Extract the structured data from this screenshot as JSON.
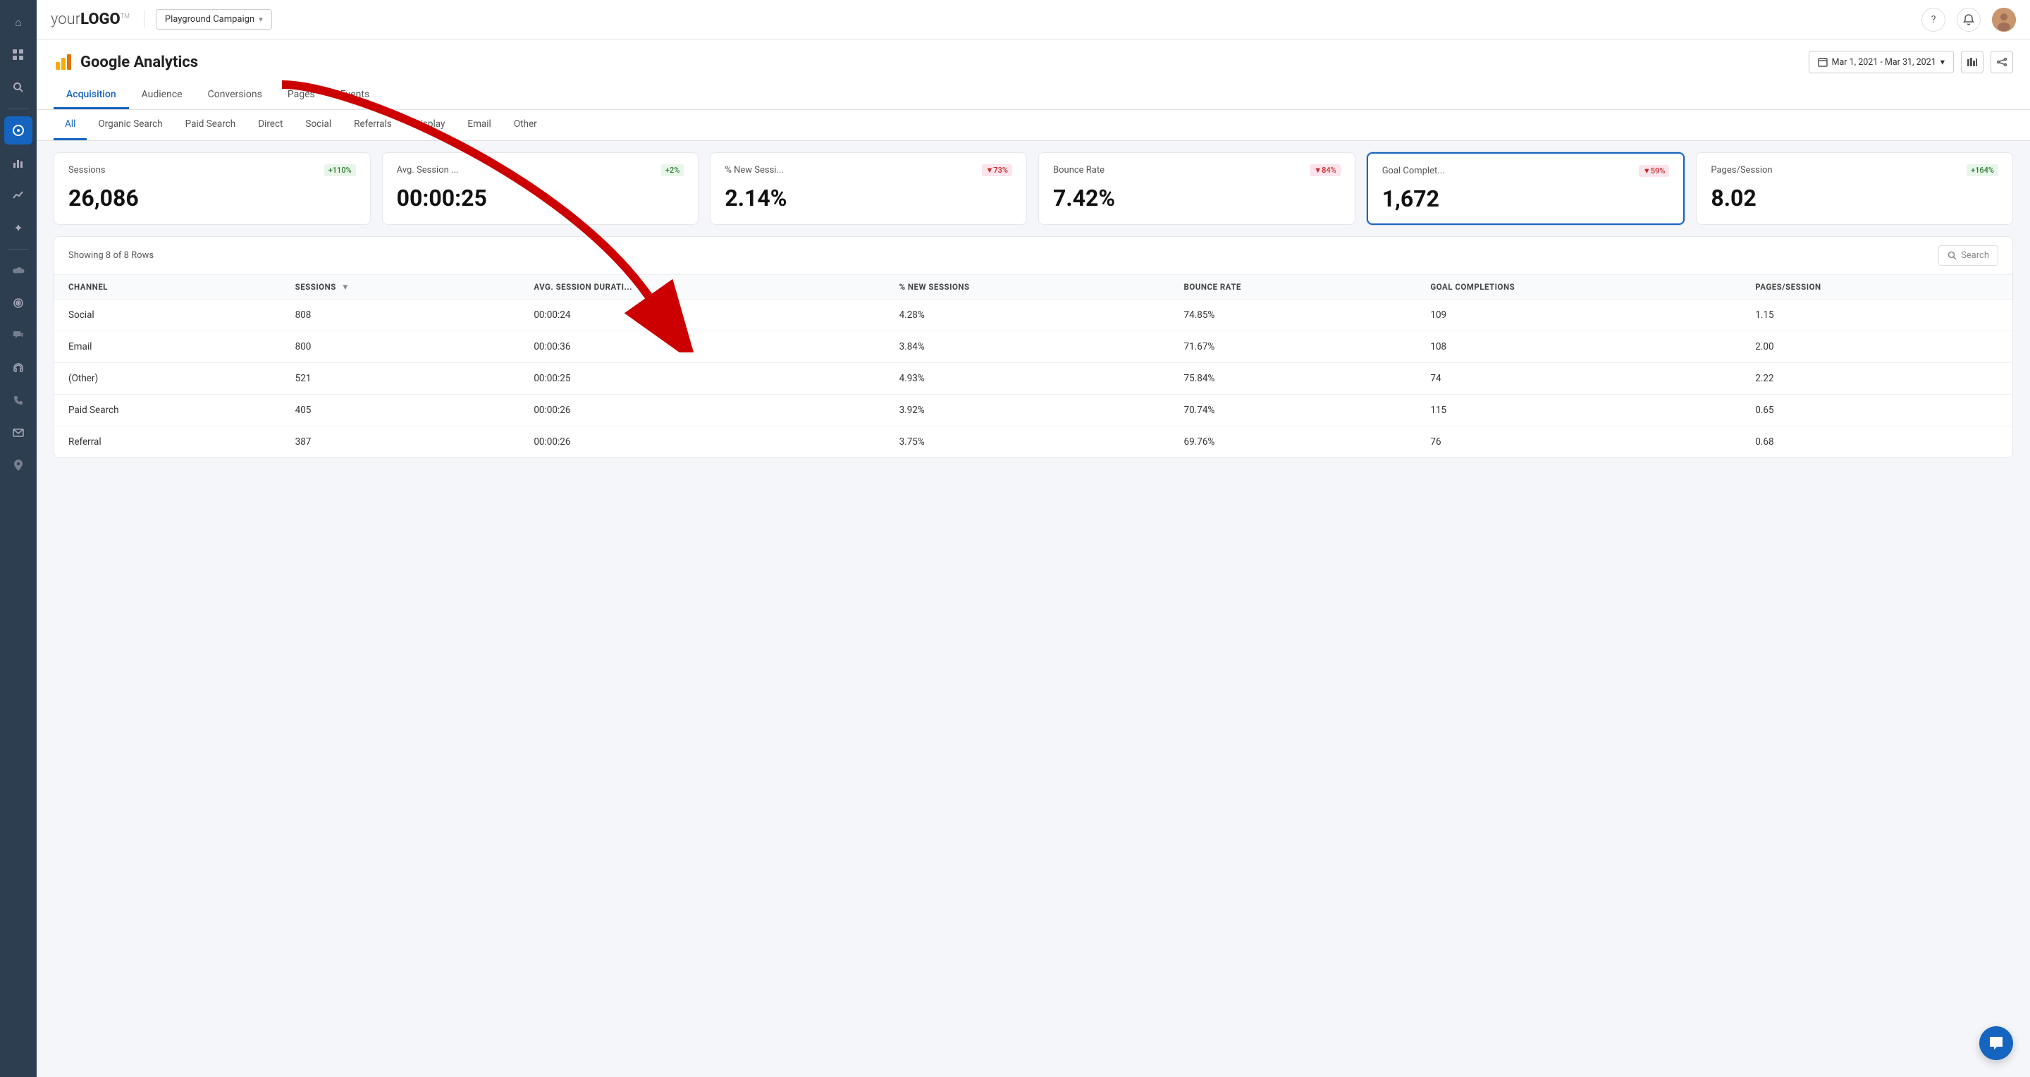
{
  "logo": {
    "text_before": "your",
    "text_bold": "LOGO",
    "tm": "TM"
  },
  "campaign": {
    "label": "Playground Campaign",
    "arrow": "▾"
  },
  "header": {
    "help_icon": "?",
    "bell_icon": "🔔"
  },
  "date_range": {
    "label": "Mar 1, 2021 - Mar 31, 2021",
    "arrow": "▾"
  },
  "main_nav": {
    "tabs": [
      {
        "label": "Acquisition",
        "active": true
      },
      {
        "label": "Audience",
        "active": false
      },
      {
        "label": "Conversions",
        "active": false
      },
      {
        "label": "Pages",
        "active": false
      },
      {
        "label": "Events",
        "active": false
      }
    ]
  },
  "sub_nav": {
    "tabs": [
      {
        "label": "All",
        "active": true
      },
      {
        "label": "Organic Search",
        "active": false
      },
      {
        "label": "Paid Search",
        "active": false
      },
      {
        "label": "Direct",
        "active": false
      },
      {
        "label": "Social",
        "active": false
      },
      {
        "label": "Referrals",
        "active": false
      },
      {
        "label": "Display",
        "active": false
      },
      {
        "label": "Email",
        "active": false
      },
      {
        "label": "Other",
        "active": false
      }
    ]
  },
  "metrics": [
    {
      "label": "Sessions",
      "value": "26,086",
      "badge": "+110%",
      "direction": "up",
      "highlighted": false
    },
    {
      "label": "Avg. Session ...",
      "value": "00:00:25",
      "badge": "+2%",
      "direction": "up",
      "highlighted": false
    },
    {
      "label": "% New Sessi...",
      "value": "2.14%",
      "badge": "▼73%",
      "direction": "down",
      "highlighted": false
    },
    {
      "label": "Bounce Rate",
      "value": "7.42%",
      "badge": "▼84%",
      "direction": "down",
      "highlighted": false
    },
    {
      "label": "Goal Complet...",
      "value": "1,672",
      "badge": "▼59%",
      "direction": "down",
      "highlighted": true
    },
    {
      "label": "Pages/Session",
      "value": "8.02",
      "badge": "+164%",
      "direction": "up",
      "highlighted": false
    }
  ],
  "table": {
    "rows_info": "Showing 8 of 8 Rows",
    "search_placeholder": "Search",
    "columns": [
      {
        "label": "CHANNEL",
        "sortable": false
      },
      {
        "label": "SESSIONS",
        "sortable": true
      },
      {
        "label": "AVG. SESSION DURATI...",
        "sortable": false
      },
      {
        "label": "% NEW SESSIONS",
        "sortable": false
      },
      {
        "label": "BOUNCE RATE",
        "sortable": false
      },
      {
        "label": "GOAL COMPLETIONS",
        "sortable": false
      },
      {
        "label": "PAGES/SESSION",
        "sortable": false
      }
    ],
    "rows": [
      {
        "channel": "Social",
        "sessions": "808",
        "avg_session": "00:00:24",
        "new_sessions": "4.28%",
        "bounce_rate": "74.85%",
        "goal_completions": "109",
        "pages_session": "1.15"
      },
      {
        "channel": "Email",
        "sessions": "800",
        "avg_session": "00:00:36",
        "new_sessions": "3.84%",
        "bounce_rate": "71.67%",
        "goal_completions": "108",
        "pages_session": "2.00"
      },
      {
        "channel": "(Other)",
        "sessions": "521",
        "avg_session": "00:00:25",
        "new_sessions": "4.93%",
        "bounce_rate": "75.84%",
        "goal_completions": "74",
        "pages_session": "2.22"
      },
      {
        "channel": "Paid Search",
        "sessions": "405",
        "avg_session": "00:00:26",
        "new_sessions": "3.92%",
        "bounce_rate": "70.74%",
        "goal_completions": "115",
        "pages_session": "0.65"
      },
      {
        "channel": "Referral",
        "sessions": "387",
        "avg_session": "00:00:26",
        "new_sessions": "3.75%",
        "bounce_rate": "69.76%",
        "goal_completions": "76",
        "pages_session": "0.68"
      }
    ]
  },
  "sidebar": {
    "icons": [
      {
        "name": "home-icon",
        "symbol": "⌂",
        "active": false
      },
      {
        "name": "grid-icon",
        "symbol": "▦",
        "active": false
      },
      {
        "name": "search-icon",
        "symbol": "🔍",
        "active": false
      },
      {
        "name": "dashboard-icon",
        "symbol": "◉",
        "active": true
      },
      {
        "name": "chart-bar-icon",
        "symbol": "📊",
        "active": false
      },
      {
        "name": "chart-line-icon",
        "symbol": "📈",
        "active": false
      },
      {
        "name": "sparkle-icon",
        "symbol": "✦",
        "active": false
      },
      {
        "name": "cloud-icon",
        "symbol": "☁",
        "active": false
      },
      {
        "name": "location-icon",
        "symbol": "📍",
        "active": false
      },
      {
        "name": "chat-icon",
        "symbol": "💬",
        "active": false
      },
      {
        "name": "phone-icon",
        "symbol": "📞",
        "active": false
      },
      {
        "name": "mail-icon",
        "symbol": "✉",
        "active": false
      },
      {
        "name": "pin-icon",
        "symbol": "📌",
        "active": false
      }
    ]
  },
  "analytics_title": "Google Analytics",
  "colors": {
    "accent_blue": "#1565c0",
    "up_green": "#2e7d32",
    "down_red": "#c62828"
  }
}
